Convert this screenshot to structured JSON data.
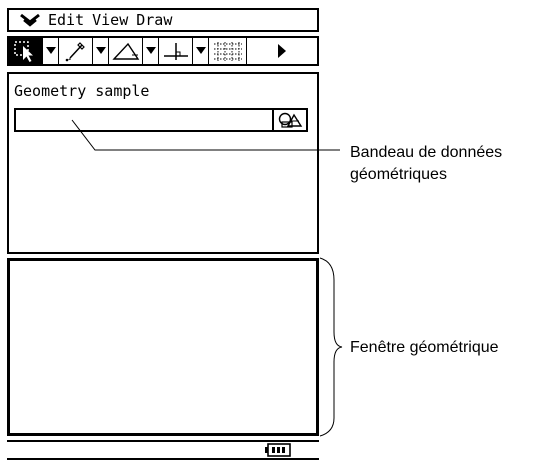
{
  "menu": {
    "icon": "chevron-down-double-icon",
    "items": [
      "Edit",
      "View",
      "Draw"
    ]
  },
  "toolbar": {
    "buttons": [
      {
        "icon": "select-arrow-icon",
        "selected": true
      },
      {
        "icon": "pencil-icon",
        "selected": false
      },
      {
        "icon": "triangle-icon",
        "selected": false
      },
      {
        "icon": "perpendicular-icon",
        "selected": false
      },
      {
        "icon": "grid-icon",
        "selected": false
      }
    ],
    "scroll_icon": "play-right-icon"
  },
  "workspace": {
    "title": "Geometry sample",
    "strip_button_icon": "geometry-data-icon"
  },
  "statusbar": {
    "battery_icon": "battery-icon"
  },
  "annotations": {
    "data_strip": {
      "line1": "Bandeau de données",
      "line2": "géométriques"
    },
    "geometry_window": {
      "label": "Fenêtre géométrique"
    }
  },
  "colors": {
    "ink": "#000000",
    "background": "#ffffff"
  }
}
